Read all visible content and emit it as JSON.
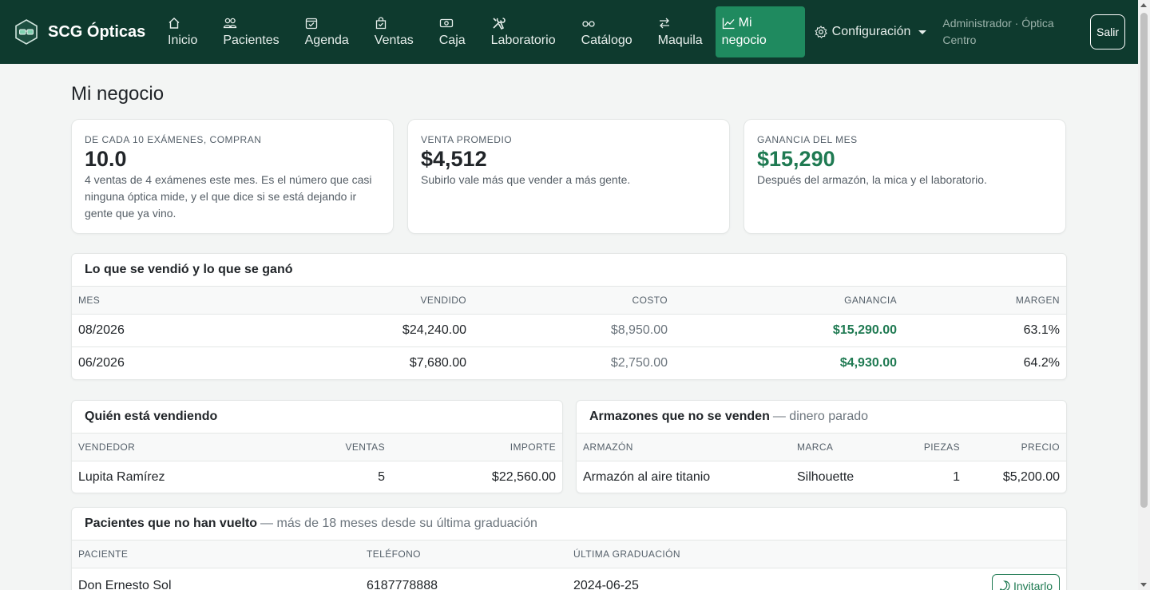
{
  "app": {
    "brand": "SCG Ópticas"
  },
  "nav": {
    "items": [
      {
        "label": "Inicio",
        "icon": "home-icon"
      },
      {
        "label": "Pacientes",
        "icon": "people-icon"
      },
      {
        "label": "Agenda",
        "icon": "calendar-icon"
      },
      {
        "label": "Ventas",
        "icon": "bag-icon"
      },
      {
        "label": "Caja",
        "icon": "cash-icon"
      },
      {
        "label": "Laboratorio",
        "icon": "tools-icon"
      },
      {
        "label": "Catálogo",
        "icon": "glasses-icon"
      },
      {
        "label": "Maquila",
        "icon": "arrows-icon"
      }
    ],
    "active": {
      "label_line1": "Mi",
      "label_line2": "negocio",
      "icon": "chart-icon"
    },
    "config": "Configuración",
    "user": "Administrador · Óptica Centro",
    "logout": "Salir"
  },
  "page": {
    "title": "Mi negocio"
  },
  "kpis": [
    {
      "label": "De cada 10 exámenes, compran",
      "value": "10.0",
      "desc": "4 ventas de 4 exámenes este mes. Es el número que casi ninguna óptica mide, y el que dice si se está dejando ir gente que ya vino."
    },
    {
      "label": "Venta promedio",
      "value": "$4,512",
      "desc": "Subirlo vale más que vender a más gente."
    },
    {
      "label": "Ganancia del mes",
      "value": "$15,290",
      "desc": "Después del armazón, la mica y el laboratorio."
    }
  ],
  "sales": {
    "title": "Lo que se vendió y lo que se ganó",
    "headers": {
      "mes": "Mes",
      "vendido": "Vendido",
      "costo": "Costo",
      "ganancia": "Ganancia",
      "margen": "Margen"
    },
    "rows": [
      {
        "mes": "08/2026",
        "vendido": "$24,240.00",
        "costo": "$8,950.00",
        "ganancia": "$15,290.00",
        "margen": "63.1%"
      },
      {
        "mes": "06/2026",
        "vendido": "$7,680.00",
        "costo": "$2,750.00",
        "ganancia": "$4,930.00",
        "margen": "64.2%"
      }
    ]
  },
  "sellers": {
    "title": "Quién está vendiendo",
    "headers": {
      "vendedor": "Vendedor",
      "ventas": "Ventas",
      "importe": "Importe"
    },
    "rows": [
      {
        "vendedor": "Lupita Ramírez",
        "ventas": "5",
        "importe": "$22,560.00"
      }
    ]
  },
  "frames": {
    "title": "Armazones que no se venden",
    "subtitle": "— dinero parado",
    "headers": {
      "armazon": "Armazón",
      "marca": "Marca",
      "piezas": "Piezas",
      "precio": "Precio"
    },
    "rows": [
      {
        "armazon": "Armazón al aire titanio",
        "marca": "Silhouette",
        "piezas": "1",
        "precio": "$5,200.00"
      }
    ]
  },
  "patients": {
    "title": "Pacientes que no han vuelto",
    "subtitle": "— más de 18 meses desde su última graduación",
    "headers": {
      "paciente": "Paciente",
      "telefono": "Teléfono",
      "graduacion": "Última graduación"
    },
    "rows": [
      {
        "paciente": "Don Ernesto Sol",
        "telefono": "6187778888",
        "graduacion": "2024-06-25",
        "action": "Invitarlo"
      }
    ]
  },
  "colors": {
    "navbar": "#0e3a2e",
    "active": "#1f8a5f",
    "gain": "#1f7a52"
  }
}
